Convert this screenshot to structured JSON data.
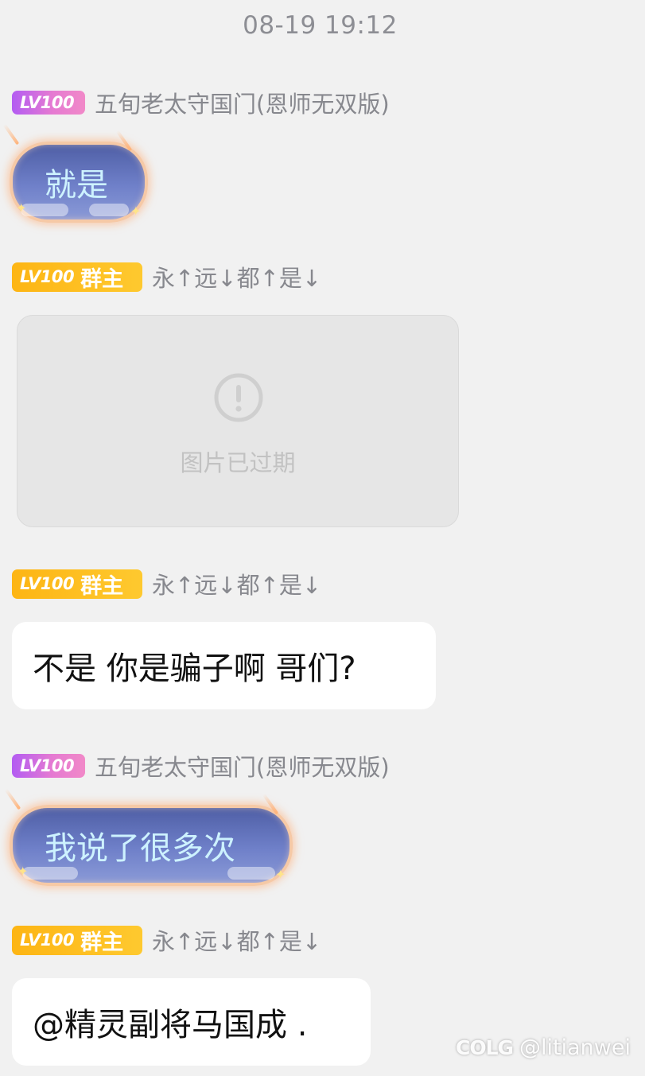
{
  "timestamp": "08-19 19:12",
  "messages": [
    {
      "level": "LV100",
      "name": "五旬老太守国门(恩师无双版)",
      "text": "就是"
    },
    {
      "level": "LV100",
      "role": "群主",
      "name": "永↑远↓都↑是↓",
      "image_status": "图片已过期",
      "icon": "exclamation-circle-icon"
    },
    {
      "level": "LV100",
      "role": "群主",
      "name": "永↑远↓都↑是↓",
      "text": "不是 你是骗子啊 哥们?"
    },
    {
      "level": "LV100",
      "name": "五旬老太守国门(恩师无双版)",
      "text": "我说了很多次"
    },
    {
      "level": "LV100",
      "role": "群主",
      "name": "永↑远↓都↑是↓",
      "text": "@精灵副将马国成 ."
    }
  ],
  "watermark": {
    "logo": "COLG",
    "user": "@litianwei"
  },
  "colors": {
    "background": "#f1f1f1",
    "badge_purple": "#c26af0",
    "badge_gold": "#fdbd1f",
    "name_text": "#87888e",
    "fancy_bubble": "#5b6bb1",
    "fancy_text": "#cdf2ff"
  }
}
